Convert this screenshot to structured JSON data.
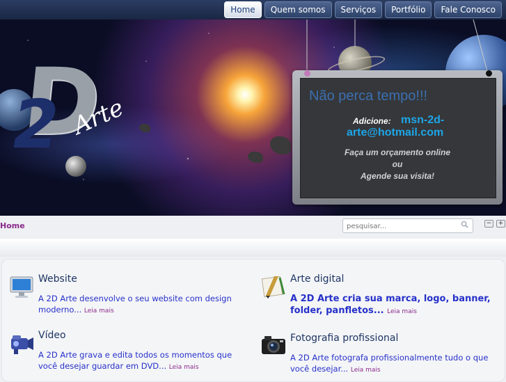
{
  "nav": {
    "items": [
      "Home",
      "Quem somos",
      "Serviços",
      "Portfólio",
      "Fale Conosco"
    ],
    "active": "Home"
  },
  "logo": {
    "big": "D",
    "small": "2",
    "script": "Arte"
  },
  "board": {
    "title": "Não perca tempo!!!",
    "add_label": "Adicione:",
    "email": "msn-2d-arte@hotmail.com",
    "line1": "Faça um orçamento online",
    "line2": "ou",
    "line3": "Agende sua visita!"
  },
  "breadcrumb": "Home",
  "search": {
    "placeholder": "pesquisar..."
  },
  "font_size_buttons": [
    "−",
    "+"
  ],
  "features": [
    {
      "title": "Website",
      "desc": "A 2D Arte desenvolve o seu website com design moderno...",
      "more": "Leia mais",
      "icon": "monitor-icon"
    },
    {
      "title": "Arte digital",
      "desc": "A 2D Arte cria sua marca, logo, banner, folder, panfletos...",
      "more": "Leia mais",
      "icon": "drawing-tools-icon"
    },
    {
      "title": "Vídeo",
      "desc": "A 2D Arte grava e edita todos os momentos que você desejar guardar em DVD...",
      "more": "Leia mais",
      "icon": "camcorder-icon"
    },
    {
      "title": "Fotografia profissional",
      "desc": "A 2D Arte fotografa profissionalmente tudo o que você desejar...",
      "more": "Leia mais",
      "icon": "camera-icon"
    }
  ],
  "colors": {
    "accent": "#1d3f7c",
    "link": "#2631c9",
    "more": "#8a2a8c",
    "email": "#1da6e8"
  }
}
